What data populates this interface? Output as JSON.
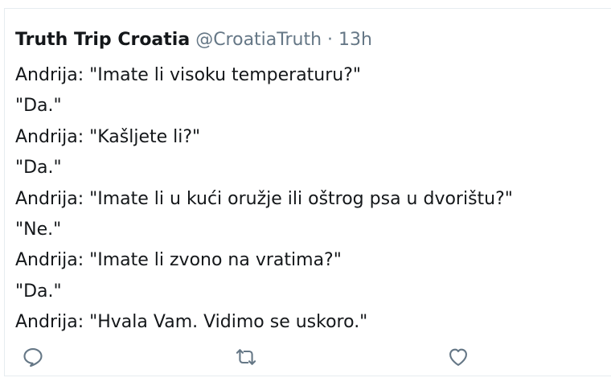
{
  "tweet": {
    "display_name": "Truth Trip Croatia",
    "handle": "@CroatiaTruth",
    "separator": "·",
    "time": "13h",
    "lines": [
      "Andrija: \"Imate li visoku temperaturu?\"",
      "\"Da.\"",
      "Andrija: \"Kašljete li?\"",
      "\"Da.\"",
      "Andrija: \"Imate li u kući oružje ili oštrog psa u dvorištu?\"",
      "\"Ne.\"",
      "Andrija: \"Imate li zvono na vratima?\"",
      "\"Da.\"",
      "Andrija: \"Hvala Vam. Vidimo se uskoro.\""
    ],
    "actions": {
      "reply_icon": "reply-icon",
      "retweet_icon": "retweet-icon",
      "like_icon": "like-icon"
    },
    "colors": {
      "text": "#14171a",
      "muted": "#657786",
      "border": "#e6ecf0"
    }
  }
}
